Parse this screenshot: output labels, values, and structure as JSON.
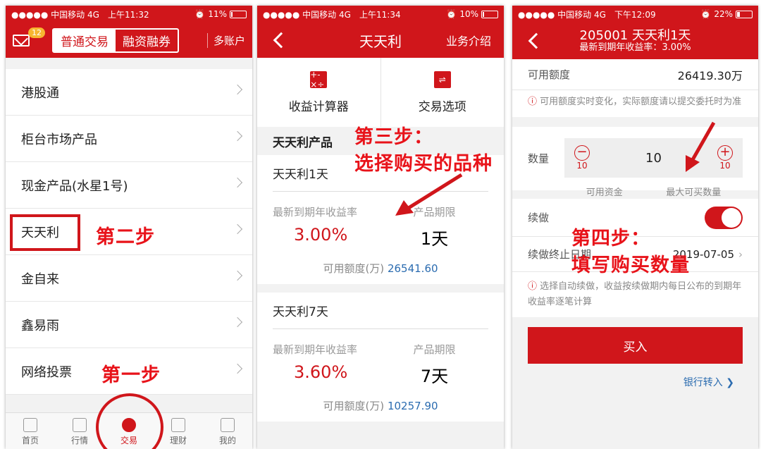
{
  "p1": {
    "status": {
      "carrier": "●●●●● 中国移动  4G",
      "time": "上午11:32",
      "battery": "11%",
      "batt_level": 0.11
    },
    "badge": "12",
    "seg": [
      "普通交易",
      "融资融券"
    ],
    "multi": "多账户",
    "items": [
      "港股通",
      "柜台市场产品",
      "现金产品(水星1号)",
      "天天利",
      "金自来",
      "鑫易雨",
      "网络投票"
    ],
    "tabs": [
      "首页",
      "行情",
      "交易",
      "理财",
      "我的"
    ],
    "ann_step1": "第一步",
    "ann_step2": "第二步"
  },
  "p2": {
    "status": {
      "carrier": "●●●●● 中国移动  4G",
      "time": "上午11:34",
      "battery": "10%",
      "batt_level": 0.1
    },
    "title": "天天利",
    "intro": "业务介绍",
    "tools": [
      {
        "icon": "+-×÷",
        "label": "收益计算器"
      },
      {
        "icon": "⇌",
        "label": "交易选项"
      }
    ],
    "section": "天天利产品",
    "cards": [
      {
        "name": "天天利1天",
        "rate_label": "最新到期年收益率",
        "rate": "3.00%",
        "term_label": "产品期限",
        "term": "1天",
        "quota_label": "可用额度(万)",
        "quota": "26541.60"
      },
      {
        "name": "天天利7天",
        "rate_label": "最新到期年收益率",
        "rate": "3.60%",
        "term_label": "产品期限",
        "term": "7天",
        "quota_label": "可用额度(万)",
        "quota": "10257.90"
      }
    ],
    "ann_step3_a": "第三步：",
    "ann_step3_b": "选择购买的品种"
  },
  "p3": {
    "status": {
      "carrier": "●●●●● 中国移动  4G",
      "time": "下午12:09",
      "battery": "22%",
      "batt_level": 0.22
    },
    "title": "205001 天天利1天",
    "subtitle": "最新到期年收益率：3.00%",
    "quota_label": "可用额度",
    "quota": "26419.30万",
    "note1": "可用额度实时变化，实际额度请以提交委托时为准",
    "qty_label": "数量",
    "qty": "10",
    "minus_sub": "10",
    "plus_sub": "10",
    "cap1": "可用资金",
    "cap2": "最大可买数量",
    "renew": "续做",
    "renew_end": "续做终止日期",
    "renew_date": "2019-07-05",
    "note2": "选择自动续做，收益按续做期内每日公布的到期年收益率逐笔计算",
    "buy": "买入",
    "bank": "银行转入",
    "ann_step4_a": "第四步：",
    "ann_step4_b": "填写购买数量"
  }
}
